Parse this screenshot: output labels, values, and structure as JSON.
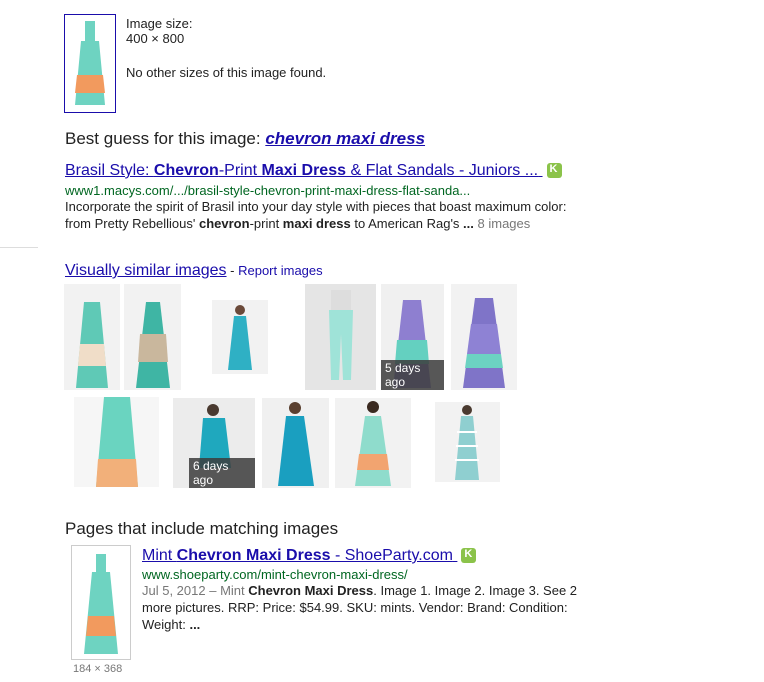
{
  "image_info": {
    "size_label": "Image size:",
    "size_value": "400 × 800",
    "no_sizes": "No other sizes of this image found."
  },
  "best_guess": {
    "prefix": "Best guess for this image:",
    "query": "chevron maxi dress"
  },
  "result1": {
    "title_a": "Brasil Style: ",
    "title_b": "Chevron",
    "title_c": "-Print ",
    "title_d": "Maxi Dress",
    "title_e": " & Flat Sandals - Juniors ...",
    "url": "www1.macys.com/.../brasil-style-chevron-print-maxi-dress-flat-sanda...",
    "snippet_1": "Incorporate the spirit of Brasil into your day style with pieces that boast maximum color:",
    "snippet_2a": "from Pretty Rebellious' ",
    "snippet_2b": "chevron",
    "snippet_2c": "-print ",
    "snippet_2d": "maxi dress",
    "snippet_2e": " to American Rag's ",
    "snippet_2f": "...",
    "images_count": "8 images"
  },
  "similar": {
    "heading": "Visually similar images",
    "separator": " - ",
    "report": "Report images",
    "badge_1": "5 days ago",
    "badge_2": "6 days ago"
  },
  "pages": {
    "heading": "Pages that include matching images",
    "title_a": "Mint ",
    "title_b": "Chevron Maxi Dress",
    "title_c": " - ShoeParty.com",
    "url": "www.shoeparty.com/mint-chevron-maxi-dress/",
    "date": "Jul 5, 2012",
    "dash": " – Mint ",
    "snip_b": "Chevron Maxi Dress",
    "snip_c": ". Image 1. Image 2. Image 3. See 2",
    "snip_2": "more pictures. RRP: Price: $54.99. SKU: mints. Vendor: Brand: Condition:",
    "snip_3": "Weight: ",
    "snip_3b": "...",
    "thumb_size": "184 × 368"
  },
  "colors": {
    "link": "#1a0dab",
    "url_green": "#006621",
    "mint": "#66d6c2",
    "orange": "#f29a5e",
    "purple": "#7f74c8"
  }
}
